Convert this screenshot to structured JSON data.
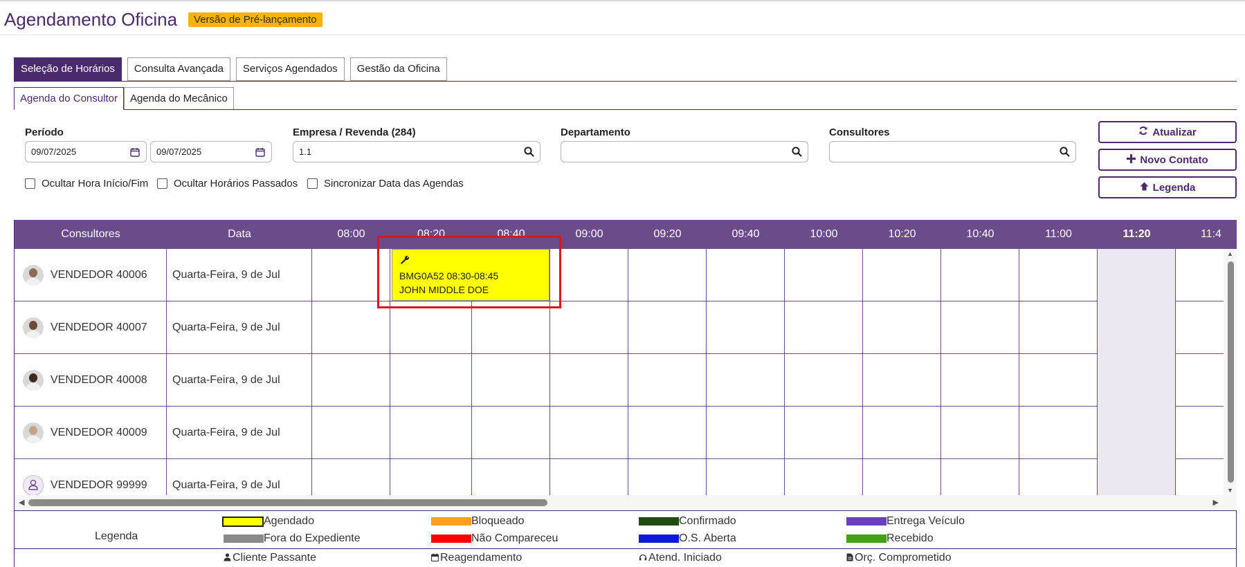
{
  "header": {
    "title": "Agendamento Oficina",
    "badge": "Versão de Pré-lançamento"
  },
  "tabs": [
    {
      "label": "Seleção de Horários",
      "active": true
    },
    {
      "label": "Consulta Avançada",
      "active": false
    },
    {
      "label": "Serviços Agendados",
      "active": false
    },
    {
      "label": "Gestão da Oficina",
      "active": false
    }
  ],
  "subtabs": [
    {
      "label": "Agenda do Consultor",
      "active": true
    },
    {
      "label": "Agenda do Mecânico",
      "active": false
    }
  ],
  "filters": {
    "periodo_label": "Período",
    "date_from": "09/07/2025",
    "date_to": "09/07/2025",
    "empresa_label": "Empresa / Revenda (284)",
    "empresa_value": "1.1",
    "departamento_label": "Departamento",
    "departamento_value": "",
    "consultores_label": "Consultores",
    "consultores_value": ""
  },
  "checkboxes": [
    {
      "label": "Ocultar Hora Início/Fim",
      "checked": false
    },
    {
      "label": "Ocultar Horários Passados",
      "checked": false
    },
    {
      "label": "Sincronizar Data das Agendas",
      "checked": false
    }
  ],
  "actions": {
    "atualizar": "Atualizar",
    "novo_contato": "Novo Contato",
    "legenda": "Legenda"
  },
  "grid": {
    "col_consultores": "Consultores",
    "col_data": "Data",
    "time_slots": [
      "08:00",
      "08:20",
      "08:40",
      "09:00",
      "09:20",
      "09:40",
      "10:00",
      "10:20",
      "10:40",
      "11:00",
      "11:20",
      "11:4"
    ],
    "current_slot": "11:20",
    "rows": [
      {
        "name": "VENDEDOR 40006",
        "date": "Quarta-Feira, 9 de Jul",
        "avatar": "photo"
      },
      {
        "name": "VENDEDOR 40007",
        "date": "Quarta-Feira, 9 de Jul",
        "avatar": "photo"
      },
      {
        "name": "VENDEDOR 40008",
        "date": "Quarta-Feira, 9 de Jul",
        "avatar": "photo"
      },
      {
        "name": "VENDEDOR 40009",
        "date": "Quarta-Feira, 9 de Jul",
        "avatar": "photo"
      },
      {
        "name": "VENDEDOR 99999",
        "date": "Quarta-Feira, 9 de Jul",
        "avatar": "user-outline-icon"
      }
    ],
    "event": {
      "icon": "wrench-icon",
      "line1": "BMG0A52 08:30-08:45",
      "line2": "JOHN MIDDLE DOE",
      "color": "#ffff00"
    }
  },
  "legend": {
    "title": "Legenda",
    "items": [
      {
        "label": "Agendado",
        "color": "#ffff00"
      },
      {
        "label": "Bloqueado",
        "color": "#ff9f1a"
      },
      {
        "label": "Confirmado",
        "color": "#1f4a10"
      },
      {
        "label": "Entrega Veículo",
        "color": "#6a3fc0"
      },
      {
        "label": "Fora do Expediente",
        "color": "#8a8a8a"
      },
      {
        "label": "Não Compareceu",
        "color": "#ff0000"
      },
      {
        "label": "O.S. Aberta",
        "color": "#0a1ad6"
      },
      {
        "label": "Recebido",
        "color": "#44a015"
      }
    ],
    "icons": [
      {
        "label": "Cliente Passante",
        "icon": "person-icon"
      },
      {
        "label": "Reagendamento",
        "icon": "calendar-icon"
      },
      {
        "label": "Atend. Iniciado",
        "icon": "headset-icon"
      },
      {
        "label": "Orç. Comprometido",
        "icon": "document-icon"
      }
    ]
  }
}
